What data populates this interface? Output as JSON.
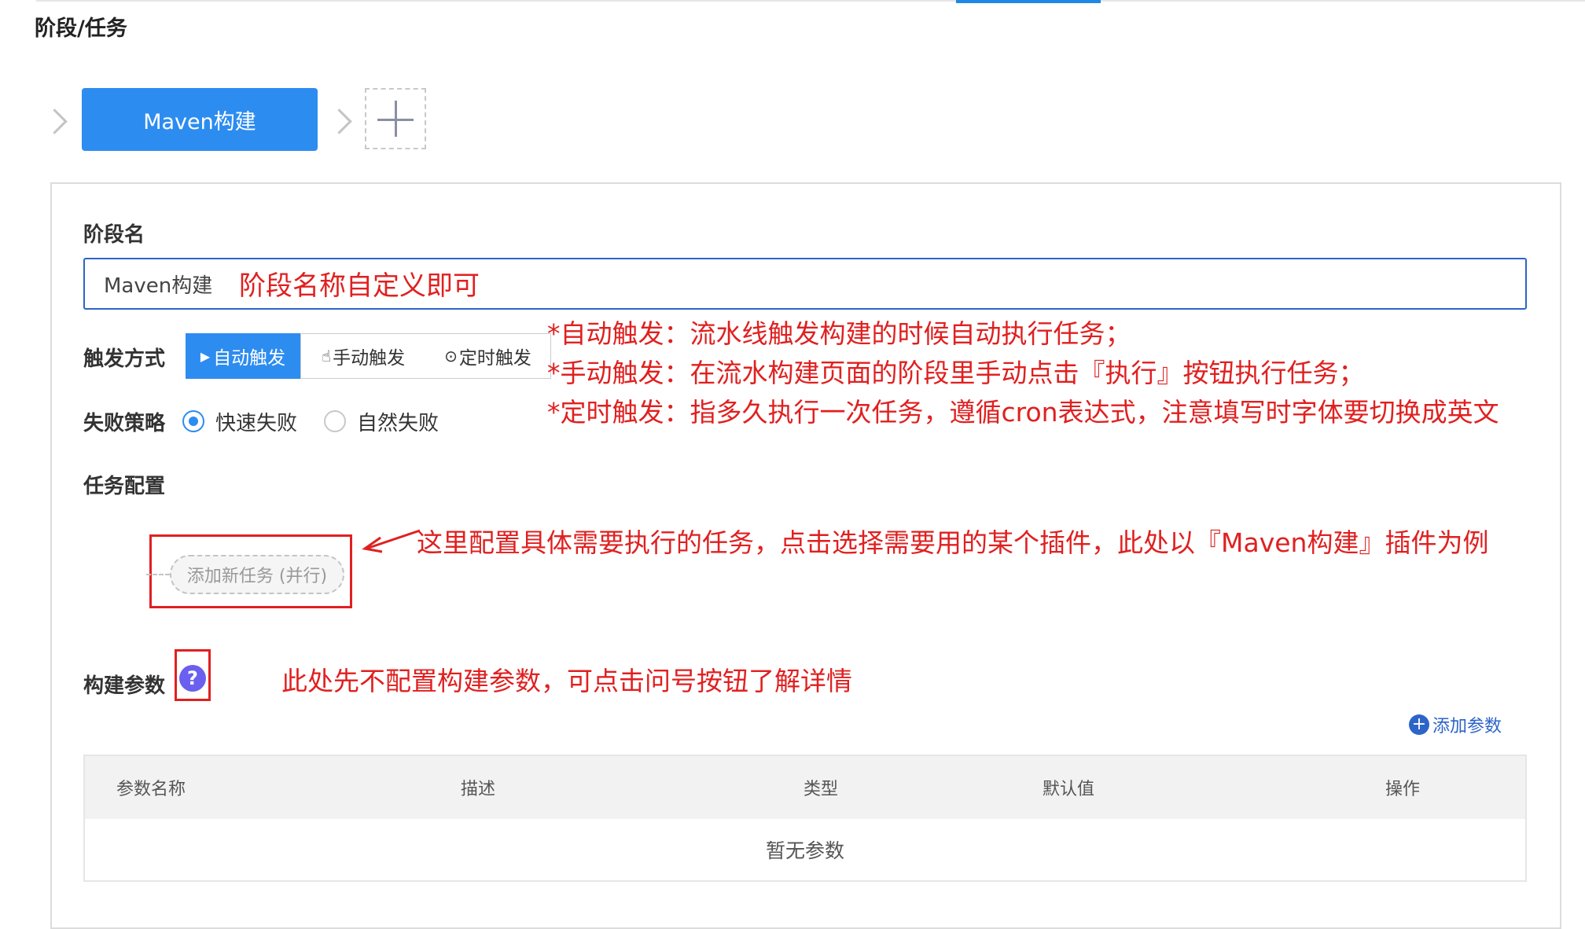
{
  "page": {
    "section_title": "阶段/任务"
  },
  "pipeline": {
    "stage_label": "Maven构建"
  },
  "form": {
    "stage_name_label": "阶段名",
    "stage_name_value": "Maven构建",
    "trigger_label": "触发方式",
    "triggers": [
      {
        "icon": "play-icon",
        "label": "自动触发",
        "selected": true
      },
      {
        "icon": "hand-pointer-icon",
        "label": "手动触发",
        "selected": false
      },
      {
        "icon": "clock-icon",
        "label": "定时触发",
        "selected": false
      }
    ],
    "fail_policy_label": "失败策略",
    "fail_options": [
      {
        "label": "快速失败",
        "selected": true
      },
      {
        "label": "自然失败",
        "selected": false
      }
    ],
    "task_config_label": "任务配置",
    "add_task_label": "添加新任务 (并行)",
    "build_params_label": "构建参数",
    "help_icon_glyph": "?",
    "add_param_label": "添加参数"
  },
  "params_table": {
    "columns": [
      "参数名称",
      "描述",
      "类型",
      "默认值",
      "操作"
    ],
    "empty_text": "暂无参数"
  },
  "annotations": {
    "stage_name_note": "阶段名称自定义即可",
    "trigger_auto": "*自动触发：流水线触发构建的时候自动执行任务；",
    "trigger_manual": "*手动触发：在流水构建页面的阶段里手动点击『执行』按钮执行任务；",
    "trigger_scheduled": "*定时触发：指多久执行一次任务，遵循cron表达式，注意填写时字体要切换成英文",
    "task_note": "这里配置具体需要执行的任务，点击选择需要用的某个插件，此处以『Maven构建』插件为例",
    "params_note": "此处先不配置构建参数，可点击问号按钮了解详情"
  },
  "colors": {
    "primary": "#2d8cf0",
    "annotation_red": "#e02020",
    "input_border": "#2d64c8"
  }
}
